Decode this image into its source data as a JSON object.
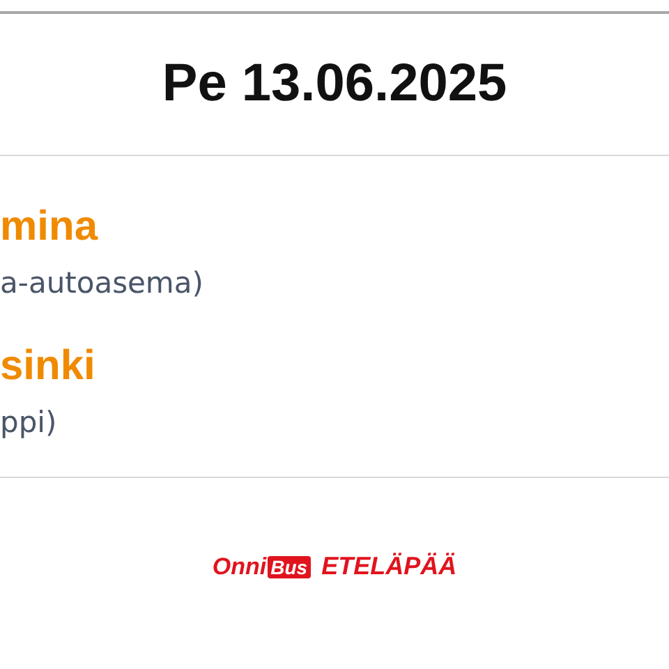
{
  "header": {
    "date": "Pe 13.06.2025"
  },
  "stops": [
    {
      "city": "mina",
      "station": "a-autoasema)"
    },
    {
      "city": "sinki",
      "station": "ppi)"
    }
  ],
  "footer": {
    "logo_left": "Onni",
    "logo_box": "Bus",
    "logo_right": "ETELÄPÄÄ"
  }
}
